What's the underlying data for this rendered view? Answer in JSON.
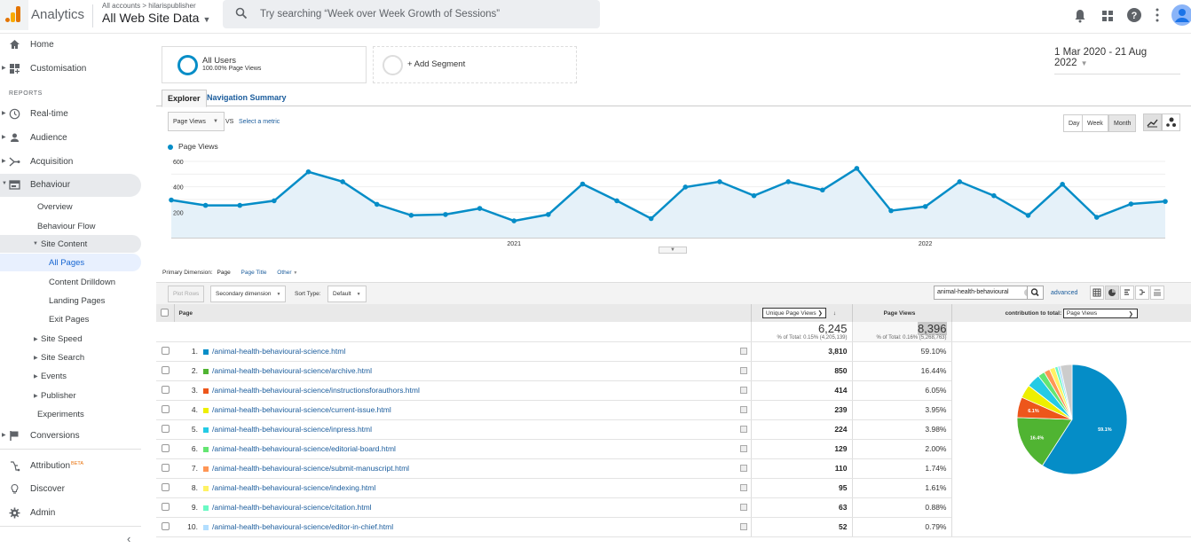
{
  "header": {
    "app_name": "Analytics",
    "breadcrumb": "All accounts > hilarispublisher",
    "property": "All Web Site Data",
    "search_placeholder": "Try searching “Week over Week Growth of Sessions”",
    "icons": [
      "bell-icon",
      "apps-grid-icon",
      "help-icon",
      "more-vert-icon",
      "account-avatar-icon"
    ]
  },
  "sidebar": {
    "top": [
      {
        "label": "Home",
        "icon": "home-icon"
      },
      {
        "label": "Customisation",
        "icon": "customisation-icon"
      }
    ],
    "reports_label": "REPORTS",
    "reports": [
      {
        "label": "Real-time",
        "icon": "clock-icon"
      },
      {
        "label": "Audience",
        "icon": "person-icon"
      },
      {
        "label": "Acquisition",
        "icon": "acquisition-icon"
      },
      {
        "label": "Behaviour",
        "icon": "behaviour-icon"
      }
    ],
    "behaviour_items": {
      "overview": "Overview",
      "flow": "Behaviour Flow",
      "site_content": "Site Content",
      "all_pages": "All Pages",
      "drilldown": "Content Drilldown",
      "landing": "Landing Pages",
      "exit": "Exit Pages",
      "site_speed": "Site Speed",
      "site_search": "Site Search",
      "events": "Events",
      "publisher": "Publisher",
      "experiments": "Experiments"
    },
    "conversions": "Conversions",
    "bottom": {
      "attribution": "Attribution",
      "beta": "BETA",
      "discover": "Discover",
      "admin": "Admin"
    },
    "collapse_glyph": "‹"
  },
  "segments": {
    "all_users_title": "All Users",
    "all_users_sub": "100.00% Page Views",
    "add_segment": "+ Add Segment"
  },
  "date_range": "1 Mar 2020 - 21 Aug 2022",
  "tabs": {
    "explorer": "Explorer",
    "nav_summary": "Navigation Summary"
  },
  "chart_controls": {
    "metric": "Page Views",
    "vs": "VS",
    "select_metric": "Select a metric",
    "granularity": [
      "Day",
      "Week",
      "Month"
    ],
    "selected_granularity": "Month"
  },
  "chart_data": {
    "type": "area",
    "series": [
      {
        "name": "Page Views",
        "color": "#058dc7",
        "values": [
          296,
          254,
          254,
          290,
          518,
          440,
          262,
          176,
          182,
          230,
          132,
          182,
          422,
          290,
          150,
          398,
          440,
          330,
          440,
          375,
          545,
          212,
          245,
          440,
          330,
          175,
          420,
          160,
          265,
          285
        ]
      }
    ],
    "x": [
      "Mar 2020",
      "Apr 2020",
      "May 2020",
      "Jun 2020",
      "Jul 2020",
      "Aug 2020",
      "Sep 2020",
      "Oct 2020",
      "Nov 2020",
      "Dec 2020",
      "Jan 2021",
      "Feb 2021",
      "Mar 2021",
      "Apr 2021",
      "May 2021",
      "Jun 2021",
      "Jul 2021",
      "Aug 2021",
      "Sep 2021",
      "Oct 2021",
      "Nov 2021",
      "Dec 2021",
      "Jan 2022",
      "Feb 2022",
      "Mar 2022",
      "Apr 2022",
      "May 2022",
      "Jun 2022",
      "Jul 2022",
      "Aug 2022"
    ],
    "x_tick_labels": [
      {
        "label": "2021",
        "at": "Jan 2021"
      },
      {
        "label": "2022",
        "at": "Jan 2022"
      }
    ],
    "y_ticks": [
      200,
      400,
      600
    ],
    "ylim": [
      0,
      600
    ],
    "legend": "top-left",
    "grid": true
  },
  "primary_dimension": {
    "label": "Primary Dimension:",
    "current": "Page",
    "options": [
      "Page Title",
      "Other"
    ]
  },
  "table_toolbar": {
    "plot_rows": "Plot Rows",
    "secondary_dimension": "Secondary dimension",
    "sort_type_label": "Sort Type:",
    "sort_type": "Default",
    "filter_value": "animal-health-behavioural",
    "advanced": "advanced"
  },
  "table": {
    "headers": {
      "page": "Page",
      "unique_page_views": "Unique Page Views",
      "page_views": "Page Views",
      "contribution_label": "contribution to total:",
      "contribution_metric": "Page Views"
    },
    "totals": {
      "unique_page_views": "6,245",
      "unique_sub": "% of Total: 0.15% (4,205,139)",
      "page_views": "8,396",
      "page_views_sub": "% of Total: 0.16% (5,268,763)"
    },
    "rows": [
      {
        "rank": "1.",
        "page": "/animal-health-behavioural-science.html",
        "color": "#058dc7",
        "upv": "3,810",
        "pv_pct": "59.10%"
      },
      {
        "rank": "2.",
        "page": "/animal-health-behavioural-science/archive.html",
        "color": "#50b432",
        "upv": "850",
        "pv_pct": "16.44%"
      },
      {
        "rank": "3.",
        "page": "/animal-health-behavioural-science/instructionsforauthors.html",
        "color": "#ed561b",
        "upv": "414",
        "pv_pct": "6.05%"
      },
      {
        "rank": "4.",
        "page": "/animal-health-behavioural-science/current-issue.html",
        "color": "#edef00",
        "upv": "239",
        "pv_pct": "3.95%"
      },
      {
        "rank": "5.",
        "page": "/animal-health-behavioural-science/inpress.html",
        "color": "#24cbe5",
        "upv": "224",
        "pv_pct": "3.98%"
      },
      {
        "rank": "6.",
        "page": "/animal-health-behavioural-science/editorial-board.html",
        "color": "#64e572",
        "upv": "129",
        "pv_pct": "2.00%"
      },
      {
        "rank": "7.",
        "page": "/animal-health-behavioural-science/submit-manuscript.html",
        "color": "#ff9655",
        "upv": "110",
        "pv_pct": "1.74%"
      },
      {
        "rank": "8.",
        "page": "/animal-health-behavioural-science/indexing.html",
        "color": "#fff263",
        "upv": "95",
        "pv_pct": "1.61%"
      },
      {
        "rank": "9.",
        "page": "/animal-health-behavioural-science/citation.html",
        "color": "#6af9c4",
        "upv": "63",
        "pv_pct": "0.88%"
      },
      {
        "rank": "10.",
        "page": "/animal-health-behavioural-science/editor-in-chief.html",
        "color": "#b2deff",
        "upv": "52",
        "pv_pct": "0.79%"
      }
    ]
  },
  "pie": {
    "slices": [
      {
        "value": 59.1,
        "color": "#058dc7",
        "label": "59.1%"
      },
      {
        "value": 16.44,
        "color": "#50b432",
        "label": "16.4%"
      },
      {
        "value": 6.05,
        "color": "#ed561b",
        "label": "6.1%"
      },
      {
        "value": 3.95,
        "color": "#edef00",
        "label": ""
      },
      {
        "value": 3.98,
        "color": "#24cbe5",
        "label": ""
      },
      {
        "value": 2.0,
        "color": "#64e572",
        "label": ""
      },
      {
        "value": 1.74,
        "color": "#ff9655",
        "label": ""
      },
      {
        "value": 1.61,
        "color": "#fff263",
        "label": ""
      },
      {
        "value": 0.88,
        "color": "#6af9c4",
        "label": ""
      },
      {
        "value": 0.79,
        "color": "#b2deff",
        "label": ""
      },
      {
        "value": 3.46,
        "color": "#cccccc",
        "label": ""
      }
    ]
  }
}
